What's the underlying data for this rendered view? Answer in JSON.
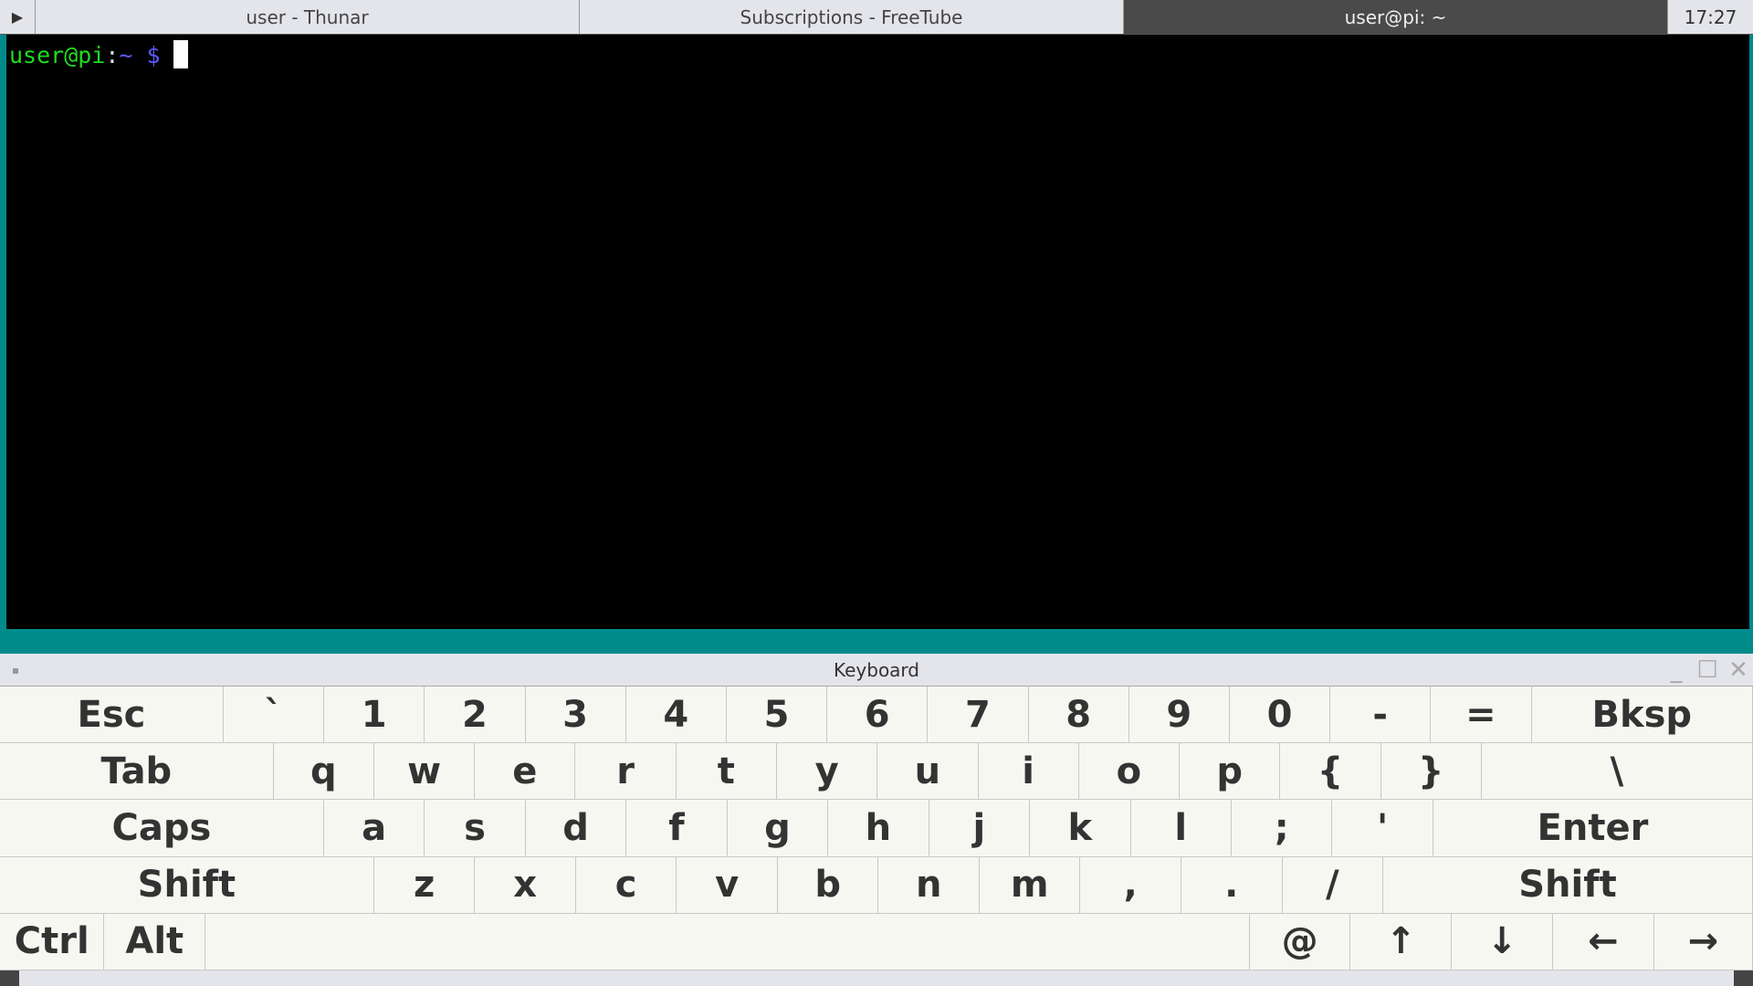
{
  "taskbar": {
    "menu_icon": "play-triangle-icon",
    "tasks": [
      {
        "label": "user - Thunar"
      },
      {
        "label": "Subscriptions - FreeTube"
      },
      {
        "label": "user@pi: ~",
        "active": true
      }
    ],
    "clock": "17:27"
  },
  "terminal": {
    "user_host": "user@pi",
    "colon": ":",
    "path": "~",
    "prompt": " $"
  },
  "keyboard": {
    "title": "Keyboard",
    "rows": [
      [
        "Esc",
        "`",
        "1",
        "2",
        "3",
        "4",
        "5",
        "6",
        "7",
        "8",
        "9",
        "0",
        "-",
        "=",
        "Bksp"
      ],
      [
        "Tab",
        "q",
        "w",
        "e",
        "r",
        "t",
        "y",
        "u",
        "i",
        "o",
        "p",
        "{",
        "}",
        "\\"
      ],
      [
        "Caps",
        "a",
        "s",
        "d",
        "f",
        "g",
        "h",
        "j",
        "k",
        "l",
        ";",
        "'",
        "Enter"
      ],
      [
        "Shift",
        "z",
        "x",
        "c",
        "v",
        "b",
        "n",
        "m",
        ",",
        ".",
        "/",
        "Shift"
      ],
      [
        "Ctrl",
        "Alt",
        "",
        "@",
        "↑",
        "↓",
        "←",
        "→"
      ]
    ]
  }
}
